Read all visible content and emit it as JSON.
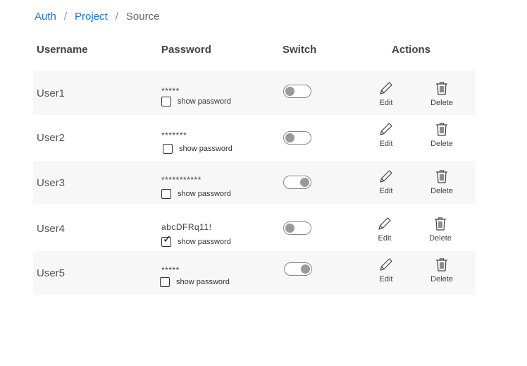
{
  "breadcrumb": {
    "items": [
      "Auth",
      "Project"
    ],
    "separator": "/",
    "current": "Source"
  },
  "table": {
    "headers": {
      "username": "Username",
      "password": "Password",
      "switch": "Switch",
      "actions": "Actions"
    },
    "show_password_label": "show password",
    "edit_label": "Edit",
    "delete_label": "Delete",
    "rows": [
      {
        "username": "User1",
        "password": "*****",
        "show_password": false,
        "switch_on": false
      },
      {
        "username": "User2",
        "password": "*******",
        "show_password": false,
        "switch_on": false
      },
      {
        "username": "User3",
        "password": "***********",
        "show_password": false,
        "switch_on": true
      },
      {
        "username": "User4",
        "password": "abcDFRq11!",
        "show_password": true,
        "switch_on": false
      },
      {
        "username": "User5",
        "password": "*****",
        "show_password": false,
        "switch_on": true
      }
    ]
  },
  "icons": {
    "edit": "pencil-icon",
    "delete": "trash-icon"
  }
}
